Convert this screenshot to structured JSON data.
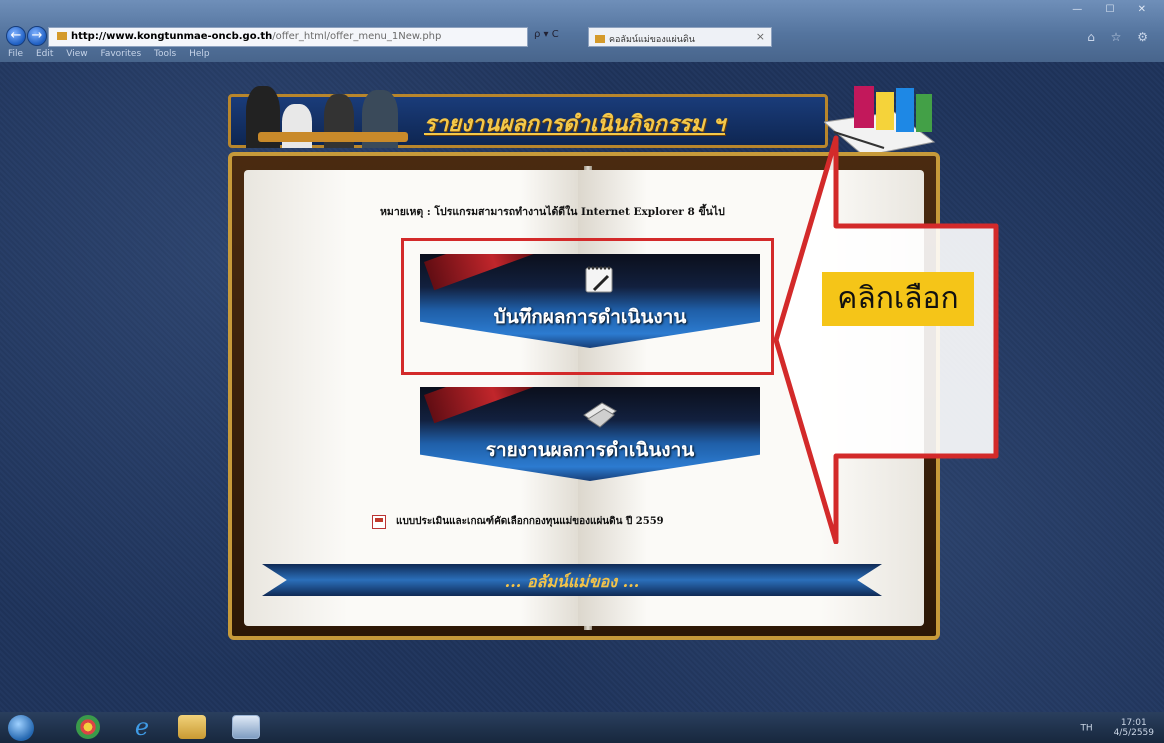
{
  "browser": {
    "address_url_domain": "http://www.kongtunmae-oncb.go.th",
    "address_url_path": "/offer_html/offer_menu_1New.php",
    "address_tools": "ρ ▾ C",
    "tab_title": "คอลัมน์แม่ของแผ่นดิน",
    "tab_close": "×",
    "menu_items": [
      "File",
      "Edit",
      "View",
      "Favorites",
      "Tools",
      "Help"
    ],
    "back_glyph": "←",
    "forward_glyph": "→",
    "window_controls": "— ☐ ✕",
    "toolbar_icons": "⌂ ☆ ⚙"
  },
  "page": {
    "banner_title": "รายงานผลการดำเนินกิจกรรม ฯ",
    "note": "หมายเหตุ : โปรแกรมสามารถทำงานได้ดีใน Internet Explorer 8 ขึ้นไป",
    "menu_buttons": [
      {
        "label": "บันทึกผลการดำเนินงาน",
        "icon": "notebook-icon"
      },
      {
        "label": "รายงานผลการดำเนินงาน",
        "icon": "documents-icon"
      }
    ],
    "pdf_link": "แบบประเมินและเกณฑ์คัดเลือกกองทุนแม่ของแผ่นดิน ปี 2559",
    "footer_ribbon": "... อลัมน์แม่ของ ..."
  },
  "annotation": {
    "callout_label": "คลิกเลือก",
    "highlight_color": "#d32a2a",
    "label_bg": "#f5c518"
  },
  "taskbar": {
    "tray_text": "TH",
    "time": "17:01",
    "date": "4/5/2559"
  }
}
